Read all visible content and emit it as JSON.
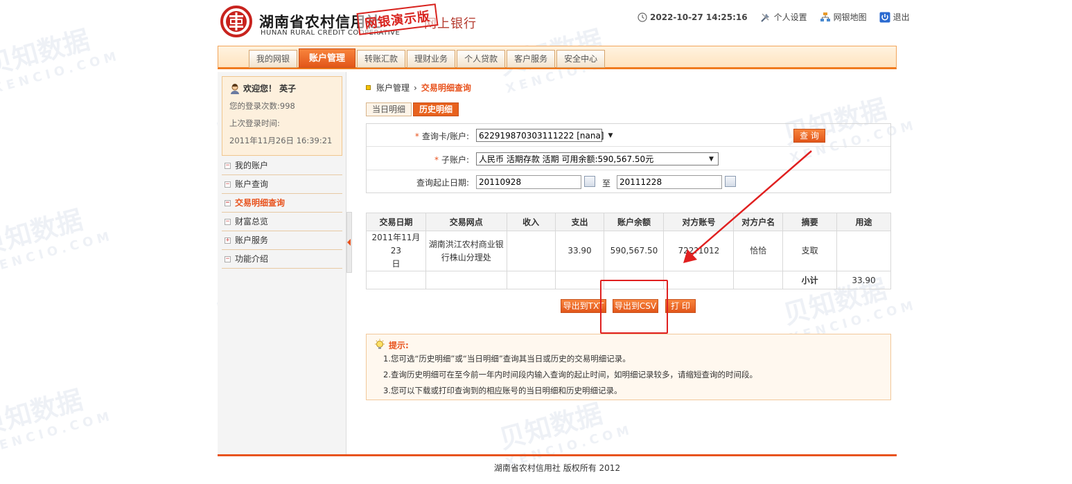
{
  "header": {
    "bank_name": "湖南省农村信用社",
    "bank_name_en": "HUNAN RURAL CREDIT COOPERATIVE",
    "bank_suffix": "网上银行",
    "demo_stamp": "网银演示版",
    "datetime": "2022-10-27 14:25:16",
    "settings": "个人设置",
    "sitemap": "网银地图",
    "logout": "退出"
  },
  "nav": {
    "tabs": [
      "我的网银",
      "账户管理",
      "转账汇款",
      "理财业务",
      "个人贷款",
      "客户服务",
      "安全中心"
    ],
    "active_index": 1
  },
  "sidebar": {
    "welcome": "欢迎您！ 英子",
    "login_count": "您的登录次数:998",
    "last_login_label": "上次登录时间:",
    "last_login_time": "2011年11月26日 16:39:21",
    "menu": [
      {
        "label": "我的账户",
        "sign": "−"
      },
      {
        "label": "账户查询",
        "sign": "−"
      },
      {
        "label": "交易明细查询",
        "sign": "−"
      },
      {
        "label": "财富总览",
        "sign": "−"
      },
      {
        "label": "账户服务",
        "sign": "+"
      },
      {
        "label": "功能介绍",
        "sign": "−"
      }
    ],
    "active_index": 2
  },
  "breadcrumb": {
    "parent": "账户管理",
    "separator": "›",
    "current": "交易明细查询"
  },
  "subtabs": [
    "当日明细",
    "历史明细"
  ],
  "subtab_active": 1,
  "query": {
    "card_label": "查询卡/账户:",
    "card_value": "622919870303111222 [nana]",
    "sub_label": "子账户:",
    "sub_value": "人民币 活期存款 活期 可用余额:590,567.50元",
    "date_label": "查询起止日期:",
    "date_from": "20110928",
    "date_to_sep": "至",
    "date_to": "20111228",
    "query_button": "查 询",
    "required_mark": "*"
  },
  "table": {
    "headers": [
      "交易日期",
      "交易网点",
      "收入",
      "支出",
      "账户余额",
      "对方账号",
      "对方户名",
      "摘要",
      "用途"
    ],
    "rows": [
      {
        "date_line1": "2011年11月23",
        "date_line2": "日",
        "branch_line1": "湖南洪江农村商业银",
        "branch_line2": "行株山分理处",
        "income": "",
        "expense": "33.90",
        "balance": "590,567.50",
        "counter_account": "722?1012",
        "counter_name": "恰恰",
        "summary": "支取",
        "purpose": ""
      }
    ],
    "total_label": "小计",
    "total_value": "33.90"
  },
  "export": {
    "txt": "导出到TXT",
    "csv": "导出到CSV",
    "print": "打 印"
  },
  "tips": {
    "title": "提示:",
    "lines": [
      "1.您可选“历史明细”或“当日明细”查询其当日或历史的交易明细记录。",
      "2.查询历史明细可在至今前一年内时间段内输入查询的起止时间，如明细记录较多，请缩短查询的时间段。",
      "3.您可以下载或打印查询到的相应账号的当日明细和历史明细记录。"
    ]
  },
  "footer": {
    "copyright": "湖南省农村信用社 版权所有 2012"
  },
  "watermark": {
    "text": "贝知数据",
    "sub": "XENCIO.COM"
  },
  "colors": {
    "accent": "#e8531e",
    "nav_bg": "#ffe3bf",
    "annotation": "#e02020"
  }
}
